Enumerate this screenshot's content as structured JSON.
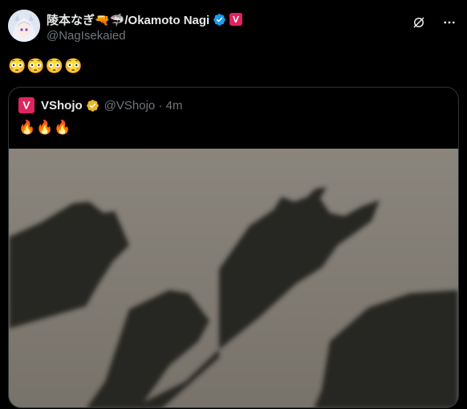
{
  "author": {
    "display_name": "陵本なぎ🔫🦈/Okamoto Nagi",
    "handle": "@NagIsekaied"
  },
  "tweet": {
    "text": "😳😳😳😳"
  },
  "icons": {
    "verified": "verified-check-icon",
    "affiliate": "vshojo-badge-icon",
    "grok": "grok-icon",
    "more": "more-dots-icon"
  },
  "quote": {
    "display_name": "VShojo",
    "handle": "@VShojo · 4m",
    "text": "🔥🔥🔥",
    "image_alt": "Shadows of raised hands on concrete"
  },
  "colors": {
    "background": "#000000",
    "text": "#e7e9ea",
    "muted": "#71767b",
    "verified_blue": "#1d9bf0",
    "verified_gold": "#e8b829",
    "brand_pink": "#e0245e",
    "border": "#2f3336"
  }
}
